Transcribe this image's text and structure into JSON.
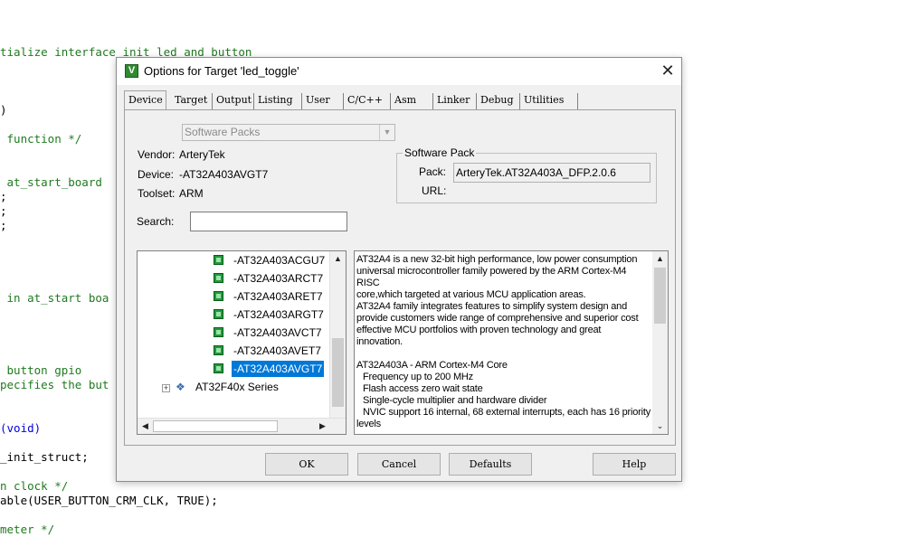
{
  "code": {
    "lines": [
      {
        "text": "tialize interface init led and button",
        "cls": "c-comment"
      },
      {
        "text": ")",
        "cls": "c-plain"
      },
      {
        "text": " function */",
        "cls": "c-comment"
      },
      {
        "text": " at_start_board",
        "cls": "c-comment"
      },
      {
        "text": ";",
        "cls": "c-plain"
      },
      {
        "text": ";",
        "cls": "c-plain"
      },
      {
        "text": ";",
        "cls": "c-plain"
      },
      {
        "text": " in at_start boa",
        "cls": "c-comment"
      },
      {
        "text": " button gpio",
        "cls": "c-comment"
      },
      {
        "text": "pecifies the but",
        "cls": "c-comment"
      },
      {
        "text": "(void)",
        "cls": "c-kw"
      },
      {
        "text": "_init_struct;",
        "cls": "c-plain"
      },
      {
        "text": "n clock */",
        "cls": "c-comment"
      },
      {
        "text": "able(USER_BUTTON_CRM_CLK, TRUE);",
        "cls": "c-plain"
      },
      {
        "text": "meter */",
        "cls": "c-comment"
      }
    ]
  },
  "dialog": {
    "title": "Options for Target 'led_toggle'",
    "app_icon_glyph": "V",
    "close_glyph": "✕",
    "tabs": [
      "Device",
      "Target",
      "Output",
      "Listing",
      "User",
      "C/C++",
      "Asm",
      "Linker",
      "Debug",
      "Utilities"
    ],
    "active_tab": "Device",
    "device": {
      "packs_combo": "Software Packs",
      "vendor_label": "Vendor:",
      "vendor_value": "ArteryTek",
      "device_label": "Device:",
      "device_value": "-AT32A403AVGT7",
      "toolset_label": "Toolset:",
      "toolset_value": "ARM",
      "search_label": "Search:",
      "search_value": "",
      "software_pack": {
        "title": "Software Pack",
        "pack_label": "Pack:",
        "pack_value": "ArteryTek.AT32A403A_DFP.2.0.6",
        "url_label": "URL:"
      },
      "tree": {
        "items": [
          "-AT32A403ACGU7",
          "-AT32A403ARCT7",
          "-AT32A403ARET7",
          "-AT32A403ARGT7",
          "-AT32A403AVCT7",
          "-AT32A403AVET7",
          "-AT32A403AVGT7"
        ],
        "selected": "-AT32A403AVGT7",
        "expander_glyph": "+",
        "series_label": "AT32F40x Series"
      },
      "description": [
        {
          "text": "AT32A4 is a new 32-bit high performance, low power consumption",
          "indent": false
        },
        {
          "text": "universal microcontroller family powered by the ARM Cortex-M4 RISC",
          "indent": false
        },
        {
          "text": "core,which targeted at various MCU application areas.",
          "indent": false
        },
        {
          "text": "AT32A4 family integrates features to simplify system design and",
          "indent": false
        },
        {
          "text": "provide customers wide range of comprehensive and superior cost",
          "indent": false
        },
        {
          "text": "effective MCU portfolios with proven technology and great",
          "indent": false
        },
        {
          "text": "innovation.",
          "indent": false
        },
        {
          "text": "",
          "indent": false
        },
        {
          "text": "AT32A403A - ARM Cortex-M4 Core",
          "indent": false
        },
        {
          "text": "Frequency up to 200 MHz",
          "indent": true
        },
        {
          "text": "Flash access zero wait state",
          "indent": true
        },
        {
          "text": "Single-cycle multiplier and hardware divider",
          "indent": true
        },
        {
          "text": "NVIC support 16 internal, 68 external interrupts, each has 16 priority",
          "indent": true
        },
        {
          "text": "levels",
          "indent": false
        }
      ]
    },
    "buttons": {
      "ok": "OK",
      "cancel": "Cancel",
      "defaults": "Defaults",
      "help": "Help"
    },
    "scroll_glyphs": {
      "up": "▲",
      "down": "▼",
      "left": "◀",
      "right": "▶",
      "down_small": "⌄"
    }
  }
}
